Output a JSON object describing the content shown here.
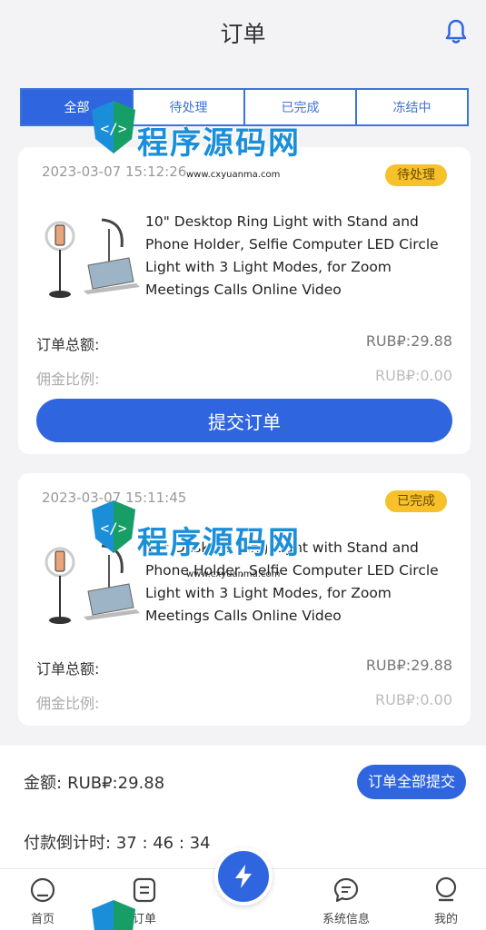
{
  "header": {
    "title": "订单"
  },
  "tabs": [
    {
      "label": "全部",
      "active": true
    },
    {
      "label": "待处理",
      "active": false
    },
    {
      "label": "已完成",
      "active": false
    },
    {
      "label": "冻结中",
      "active": false
    }
  ],
  "orders": [
    {
      "date": "2023-03-07 15:12:26",
      "status": "待处理",
      "product_name": "10\" Desktop Ring Light with Stand and Phone Holder, Selfie Computer LED Circle Light with 3 Light Modes, for Zoom Meetings Calls Online Video",
      "total_label": "订单总额:",
      "total_value": "RUB₽:29.88",
      "commission_label": "佣金比例:",
      "commission_value": "RUB₽:0.00",
      "submit_label": "提交订单"
    },
    {
      "date": "2023-03-07 15:11:45",
      "status": "已完成",
      "product_name": "10\" Desktop Ring Light with Stand and Phone Holder, Selfie Computer LED Circle Light with 3 Light Modes, for Zoom Meetings Calls Online Video",
      "total_label": "订单总额:",
      "total_value": "RUB₽:29.88",
      "commission_label": "佣金比例:",
      "commission_value": "RUB₽:0.00"
    }
  ],
  "summary": {
    "amount_label": "金额:",
    "amount_value": "RUB₽:29.88",
    "submit_all_label": "订单全部提交",
    "countdown_label": "付款倒计时:",
    "countdown_value": "37 : 46 : 34"
  },
  "tabbar": {
    "home": "首页",
    "orders": "订单",
    "messages": "系统信息",
    "mine": "我的"
  },
  "watermark": {
    "text": "程序源码网",
    "url": "www.cxyuanma.com"
  },
  "colors": {
    "primary": "#2f66e0",
    "badge": "#f6c12a",
    "background": "#f3f3f5"
  }
}
